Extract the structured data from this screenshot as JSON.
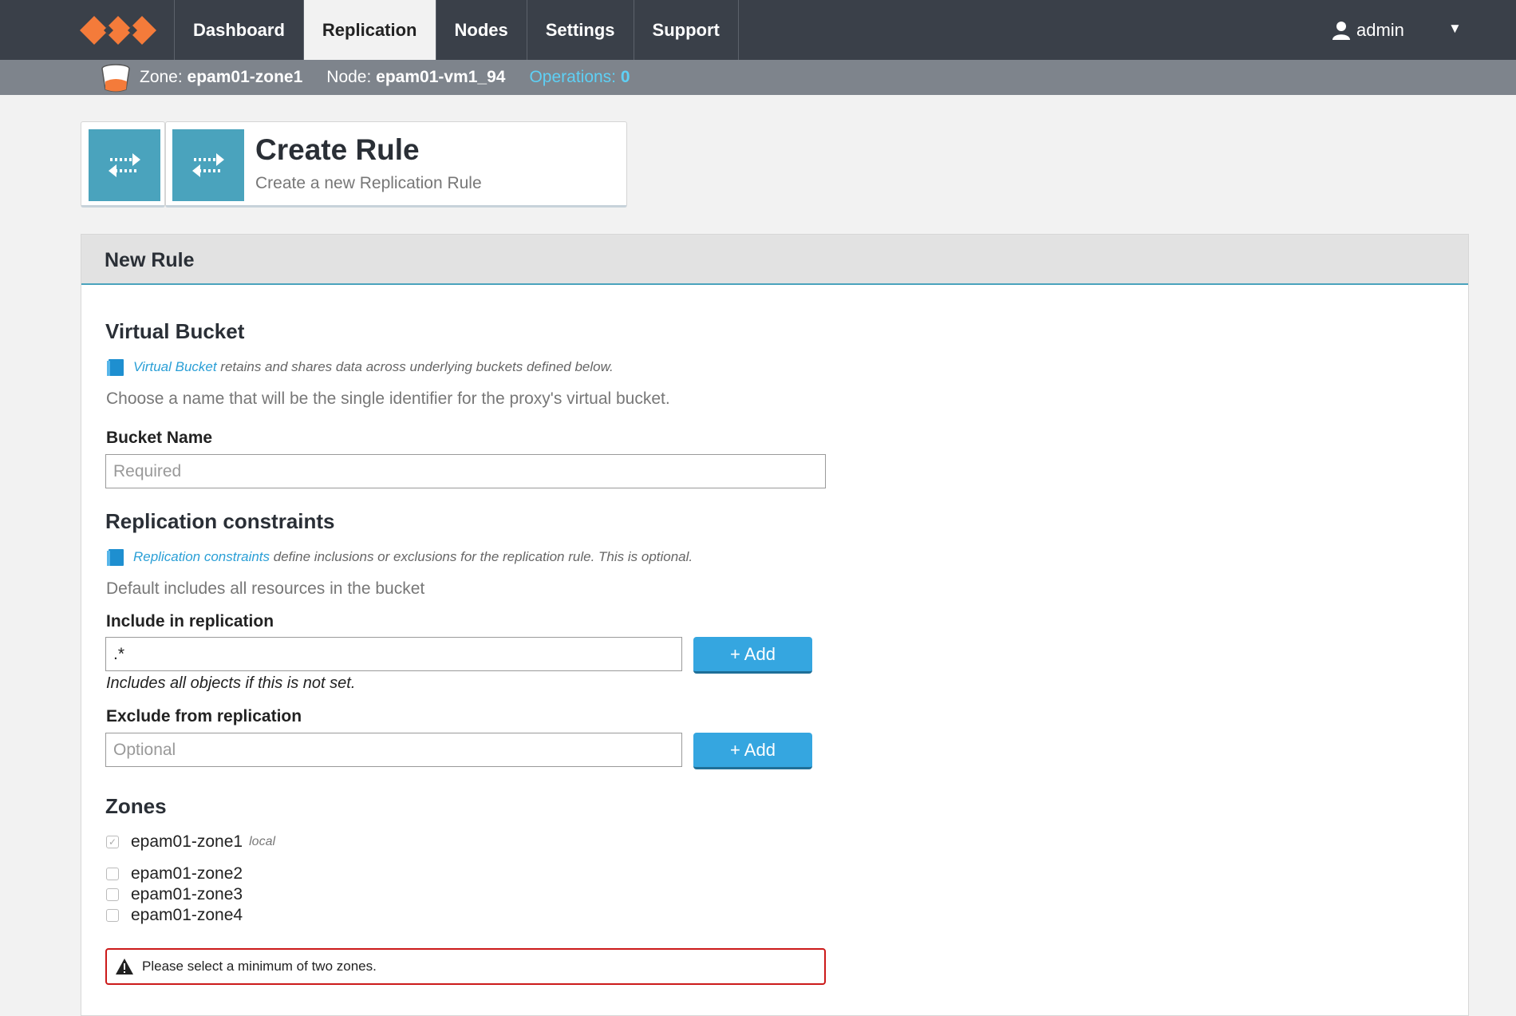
{
  "nav": {
    "items": [
      {
        "label": "Dashboard",
        "active": false
      },
      {
        "label": "Replication",
        "active": true
      },
      {
        "label": "Nodes",
        "active": false
      },
      {
        "label": "Settings",
        "active": false
      },
      {
        "label": "Support",
        "active": false
      }
    ],
    "user": "admin",
    "logo_icon": "swarm-logo-icon",
    "user_icon": "user-icon",
    "caret": "▼"
  },
  "status_bar": {
    "zone_label": "Zone:",
    "zone_value": "epam01-zone1",
    "node_label": "Node:",
    "node_value": "epam01-vm1_94",
    "operations_label": "Operations:",
    "operations_value": "0"
  },
  "header": {
    "title": "Create Rule",
    "subtitle": "Create a new Replication Rule",
    "icon": "replication-arrows-icon"
  },
  "panel": {
    "title": "New Rule",
    "virtual_bucket": {
      "title": "Virtual Bucket",
      "doc_link": "Virtual Bucket",
      "doc_text": " retains and shares data across underlying buckets defined below.",
      "help": "Choose a name that will be the single identifier for the proxy's virtual bucket.",
      "name_label": "Bucket Name",
      "name_placeholder": "Required",
      "name_value": ""
    },
    "constraints": {
      "title": "Replication constraints",
      "doc_link": "Replication constraints",
      "doc_text": " define inclusions or exclusions for the replication rule. This is optional.",
      "help": "Default includes all resources in the bucket",
      "include_label": "Include in replication",
      "include_value": ".*",
      "include_note": "Includes all objects if this is not set.",
      "exclude_label": "Exclude from replication",
      "exclude_placeholder": "Optional",
      "exclude_value": "",
      "add_label": "+ Add"
    },
    "zones": {
      "title": "Zones",
      "items": [
        {
          "name": "epam01-zone1",
          "tag": "local",
          "checked": true,
          "disabled": true
        },
        {
          "name": "epam01-zone2",
          "tag": "",
          "checked": false,
          "disabled": false
        },
        {
          "name": "epam01-zone3",
          "tag": "",
          "checked": false,
          "disabled": false
        },
        {
          "name": "epam01-zone4",
          "tag": "",
          "checked": false,
          "disabled": false
        }
      ]
    },
    "alert": {
      "text": "Please select a minimum of two zones.",
      "color": "#cc1a1a"
    }
  },
  "colors": {
    "nav_bg": "#3a4049",
    "accent": "#4aa3bd",
    "button": "#35a6e0",
    "link": "#2a9fd6",
    "logo": "#f47b3a"
  }
}
